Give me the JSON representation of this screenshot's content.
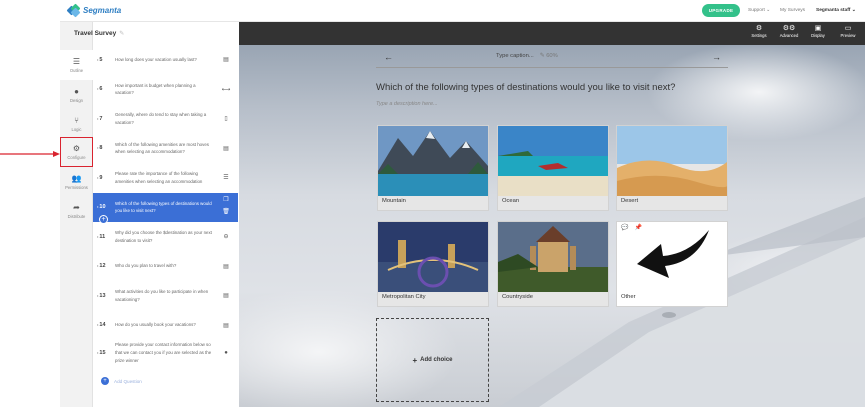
{
  "brand": {
    "logo_text": "Segmanta",
    "accent": "#2f7fc3",
    "upgrade_color": "#33c18a",
    "selected_color": "#3b6fd6",
    "highlight_color": "#d9232f"
  },
  "topbar": {
    "upgrade": "UPGRADE",
    "support": "Support ⌄",
    "my_surveys": "My Surveys",
    "user": "Segmanta staff ⌄"
  },
  "rail": [
    {
      "label": "Outline",
      "icon": "list-icon"
    },
    {
      "label": "Design",
      "icon": "paint-drop-icon"
    },
    {
      "label": "Logic",
      "icon": "branch-icon"
    },
    {
      "label": "Configure",
      "icon": "gear-icon"
    },
    {
      "label": "Permissions",
      "icon": "users-icon"
    },
    {
      "label": "Distribute",
      "icon": "share-icon"
    }
  ],
  "survey": {
    "title": "Travel Survey"
  },
  "questions": [
    {
      "num": "5",
      "text": "How long does your vacation usually last?",
      "icon": "▤"
    },
    {
      "num": "6",
      "text": "How important is budget when planning a vacation?",
      "icon": "⟷"
    },
    {
      "num": "7",
      "text": "Generally, where do tend to stay when taking a vacation?",
      "icon": "▯"
    },
    {
      "num": "8",
      "text": "Which of the following amenities are most hoves when selecting an accommodation?",
      "icon": "▤"
    },
    {
      "num": "9",
      "text": "Please rate the importance of the following amenities when selecting an accommodation",
      "icon": "☰"
    },
    {
      "num": "10",
      "text": "Which of the following types of destinations would you like to visit next?",
      "icon": "❐"
    },
    {
      "num": "11",
      "text": "Why did you choose the $destination as your next destination to visit?",
      "icon": "⊖"
    },
    {
      "num": "12",
      "text": "Who do you plan to travel with?",
      "icon": "▤"
    },
    {
      "num": "13",
      "text": "What activities do you like to participate in when vacationing?",
      "icon": "▤"
    },
    {
      "num": "14",
      "text": "How do you usually book your vacations?",
      "icon": "▤"
    },
    {
      "num": "15",
      "text": "Please provide your contact information below so that we can contact you if you are selected as the prize winner",
      "icon": "●"
    }
  ],
  "add_question": "Add Question",
  "toolbar": [
    {
      "label": "Settings",
      "icon": "gear-icon"
    },
    {
      "label": "Advanced",
      "icon": "gears-icon"
    },
    {
      "label": "Display",
      "icon": "display-icon"
    },
    {
      "label": "Preview",
      "icon": "monitor-icon"
    }
  ],
  "nav": {
    "caption": "Type caption...",
    "percent": "60%"
  },
  "question": {
    "text": "Which of the following types of destinations would you like to visit next?",
    "description": "Type a description here..."
  },
  "choices": [
    "Mountain",
    "Ocean",
    "Desert",
    "Metropolitan City",
    "Countryside",
    "Other"
  ],
  "add_choice": "Add choice"
}
